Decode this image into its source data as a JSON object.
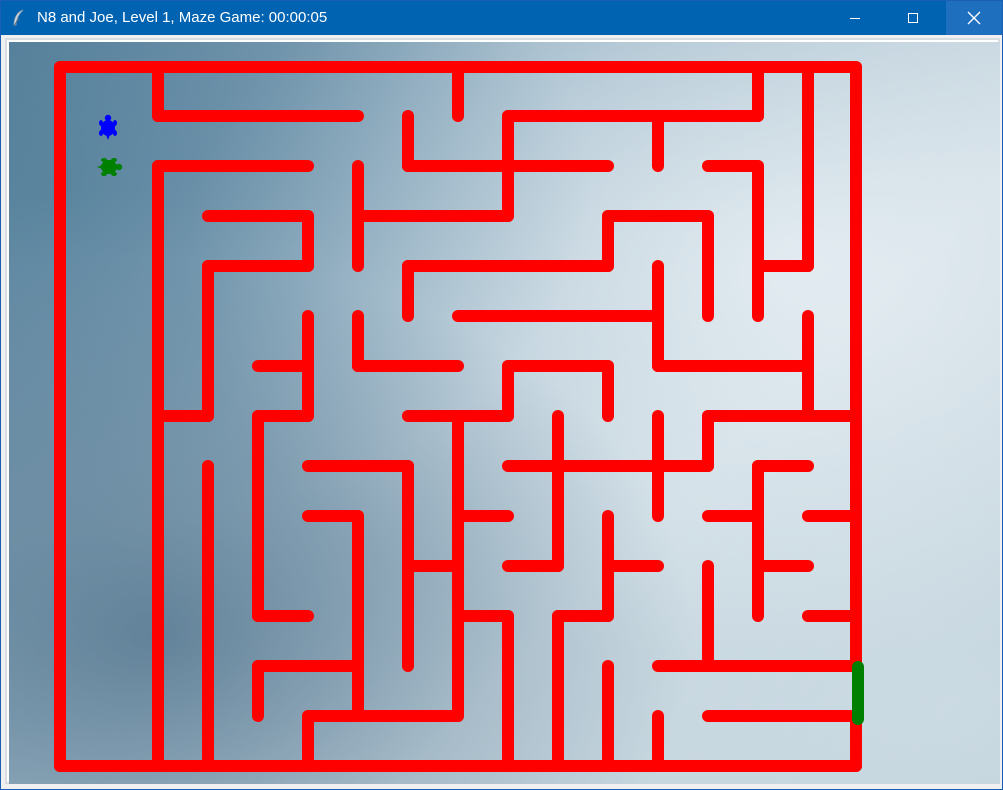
{
  "window": {
    "title": "N8 and Joe, Level 1, Maze Game: 00:00:05",
    "buttons": {
      "minimize": "minimize-icon",
      "maximize": "maximize-icon",
      "close": "close-icon"
    }
  },
  "game": {
    "level": 1,
    "elapsed": "00:00:05",
    "colors": {
      "wall": "#ff0000",
      "exit": "#008000",
      "player_blue": "#0000ff",
      "player_green": "#008000"
    },
    "players": [
      {
        "name": "blue-turtle",
        "icon": "turtle-icon",
        "color": "#0000ff"
      },
      {
        "name": "green-turtle",
        "icon": "turtle-icon",
        "color": "#008000"
      }
    ]
  }
}
